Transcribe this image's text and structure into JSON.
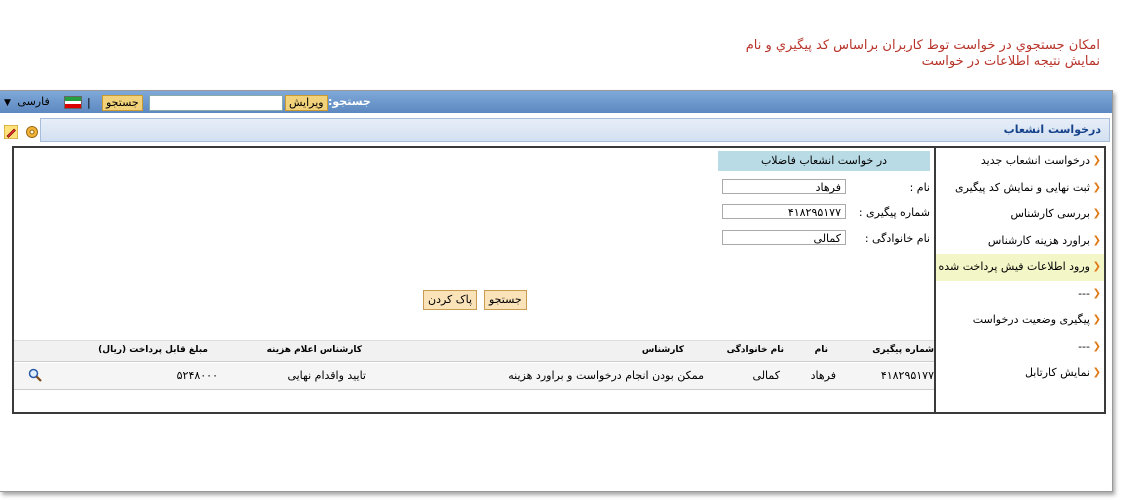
{
  "annotation": {
    "line1": "امکان جستجوي در خواست توط کاربران  براساس کد پيگيري و نام",
    "line2": "نمايش نتيجه اطلاعات در خواست"
  },
  "topbar": {
    "language": "فارسی",
    "separator": "|",
    "search_button": "جستجو",
    "edit_button": "ویرایش",
    "search_label": "جستجو:",
    "flag_colors": [
      "#239f40",
      "#ffffff",
      "#da0000"
    ]
  },
  "window": {
    "title": "درخواست انشعاب"
  },
  "sidebar": {
    "items": [
      {
        "label": "درخواست انشعاب جدید"
      },
      {
        "label": "ثبت نهایی و نمایش کد پیگیری"
      },
      {
        "label": "بررسی کارشناس"
      },
      {
        "label": "براورد هزینه کارشناس"
      },
      {
        "label": "ورود اطلاعات فیش پرداخت شده",
        "active": true
      },
      {
        "label": "---"
      },
      {
        "label": "پیگیری وضعیت درخواست"
      },
      {
        "label": "---"
      },
      {
        "label": "نمایش کارتابل"
      }
    ]
  },
  "form": {
    "header": "در خواست انشعاب فاضلاب",
    "name_label": "نام   :",
    "name_value": "فرهاد",
    "tracking_label": "شماره پیگیری  :",
    "tracking_value": "۴۱۸۲۹۵۱۷۷",
    "family_label": "نام خانوادگی  :",
    "family_value": "کمالی",
    "search_button": "جستجو",
    "clear_button": "پاک کردن"
  },
  "table": {
    "headers": {
      "tracking": "شماره پیگیری",
      "name": "نام",
      "family": "نام خانوادگی",
      "expert": "کارشناس",
      "cost_expert": "کارشناس اعلام هزینه",
      "amount": "مبلغ قابل پرداخت (ریال)"
    },
    "rows": [
      {
        "tracking": "۴۱۸۲۹۵۱۷۷",
        "name": "فرهاد",
        "family": "کمالی",
        "expert": "ممکن بودن انجام درخواست و براورد هزینه",
        "cost_expert": "تایید واقدام نهایی",
        "amount": "۵۲۴۸۰۰۰"
      }
    ]
  }
}
